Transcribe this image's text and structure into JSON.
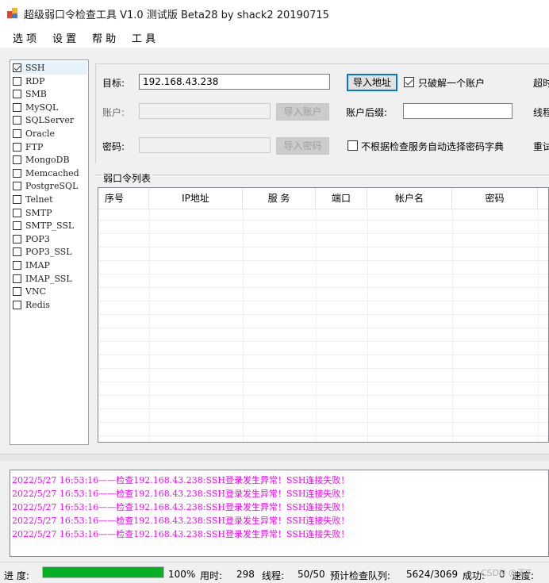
{
  "window": {
    "title": "超级弱口令检查工具 V1.0 测试版 Beta28 by shack2 20190715"
  },
  "menu": {
    "items": [
      "选 项",
      "设 置",
      "帮 助",
      "工 具"
    ]
  },
  "services": [
    {
      "label": "SSH",
      "checked": true
    },
    {
      "label": "RDP",
      "checked": false
    },
    {
      "label": "SMB",
      "checked": false
    },
    {
      "label": "MySQL",
      "checked": false
    },
    {
      "label": "SQLServer",
      "checked": false
    },
    {
      "label": "Oracle",
      "checked": false
    },
    {
      "label": "FTP",
      "checked": false
    },
    {
      "label": "MongoDB",
      "checked": false
    },
    {
      "label": "Memcached",
      "checked": false
    },
    {
      "label": "PostgreSQL",
      "checked": false
    },
    {
      "label": "Telnet",
      "checked": false
    },
    {
      "label": "SMTP",
      "checked": false
    },
    {
      "label": "SMTP_SSL",
      "checked": false
    },
    {
      "label": "POP3",
      "checked": false
    },
    {
      "label": "POP3_SSL",
      "checked": false
    },
    {
      "label": "IMAP",
      "checked": false
    },
    {
      "label": "IMAP_SSL",
      "checked": false
    },
    {
      "label": "VNC",
      "checked": false
    },
    {
      "label": "Redis",
      "checked": false
    }
  ],
  "config": {
    "target_label": "目标:",
    "target_value": "192.168.43.238",
    "import_address_label": "导入地址",
    "crack_one_label": "只破解一个账户",
    "crack_one_checked": true,
    "timeout_label": "超时",
    "account_label": "账户:",
    "account_value": "",
    "import_account_label": "导入账户",
    "account_suffix_label": "账户后缀:",
    "account_suffix_value": "",
    "threads_label": "线程",
    "password_label": "密码:",
    "password_value": "",
    "import_password_label": "导入密码",
    "auto_dict_label": "不根据检查服务自动选择密码字典",
    "auto_dict_checked": false,
    "retry_label": "重试"
  },
  "results": {
    "group_title": "弱口令列表",
    "columns": [
      "序号",
      "IP地址",
      "服 务",
      "端口",
      "帐户名",
      "密码"
    ]
  },
  "log": {
    "lines": [
      "2022/5/27 16:53:16——检查192.168.43.238:SSH登录发生异常！SSH连接失败！",
      "2022/5/27 16:53:16——检查192.168.43.238:SSH登录发生异常！SSH连接失败！",
      "2022/5/27 16:53:16——检查192.168.43.238:SSH登录发生异常！SSH连接失败！",
      "2022/5/27 16:53:16——检查192.168.43.238:SSH登录发生异常！SSH连接失败！",
      "2022/5/27 16:53:16——检查192.168.43.238:SSH登录发生异常！SSH连接失败！"
    ],
    "color": "#ff00ff"
  },
  "status": {
    "progress_label": "进 度:",
    "progress_fraction": 1.0,
    "progress_text": "100%",
    "time_label": "用时:",
    "time_value": "298",
    "threads_label": "线程:",
    "threads_value": "50/50",
    "queue_label": "预计检查队列:",
    "queue_value": "5624/3069",
    "success_label": "成功:",
    "success_value": "0",
    "speed_label": "速度:",
    "progress_color": "#06b025"
  },
  "watermark": "CSDN @不T"
}
